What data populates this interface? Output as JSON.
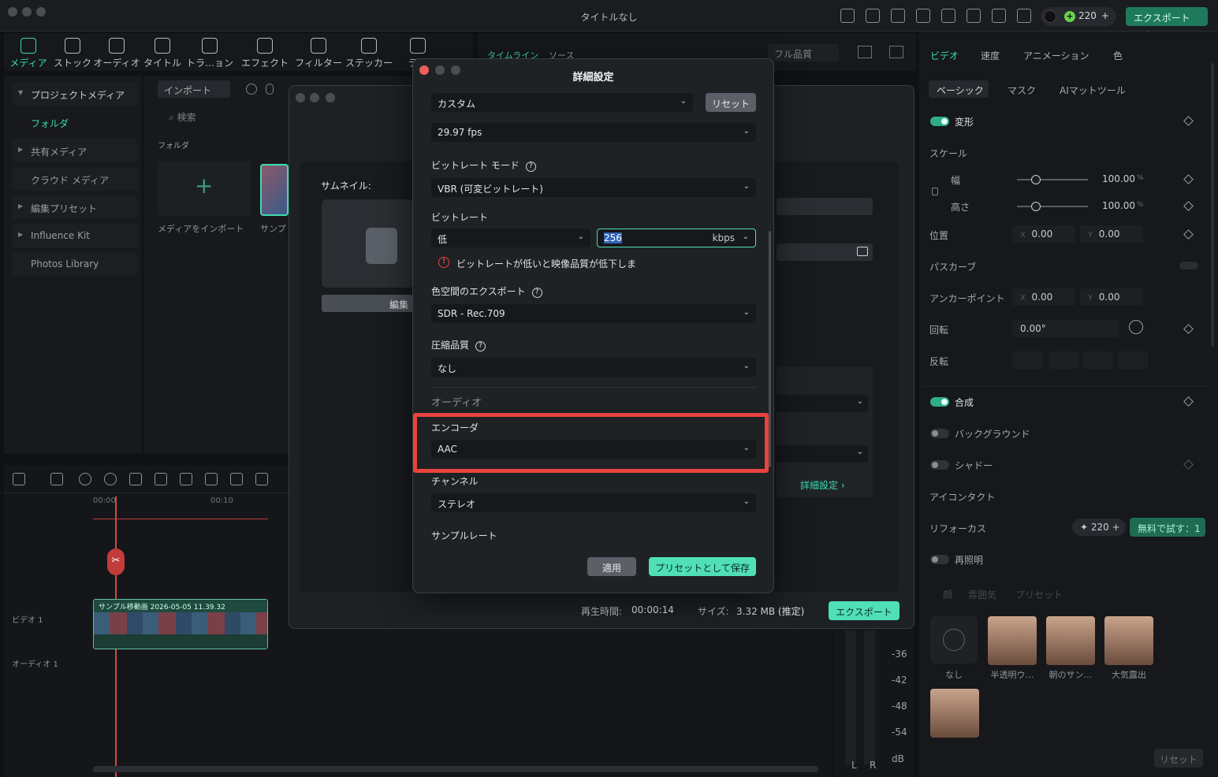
{
  "app": {
    "title": "タイトルなし",
    "credits": "220",
    "export_label": "エクスポート"
  },
  "nav": [
    {
      "label": "メディア",
      "icon": "media-icon",
      "active": true
    },
    {
      "label": "ストック",
      "icon": "stock-icon"
    },
    {
      "label": "オーディオ",
      "icon": "audio-icon"
    },
    {
      "label": "タイトル",
      "icon": "title-icon"
    },
    {
      "label": "トラ…ョン",
      "icon": "transition-icon"
    },
    {
      "label": "エフェクト",
      "icon": "effect-icon"
    },
    {
      "label": "フィルター",
      "icon": "filter-icon"
    },
    {
      "label": "ステッカー",
      "icon": "sticker-icon"
    },
    {
      "label": "テン",
      "icon": "template-icon"
    }
  ],
  "sidebar": {
    "items": [
      "プロジェクトメディア",
      "フォルダ",
      "共有メディア",
      "クラウド メディア",
      "編集プリセット",
      "Influence Kit",
      "Photos Library"
    ]
  },
  "media": {
    "import_label": "インポート",
    "search_placeholder": "検索",
    "folder_label": "フォルダ",
    "import_media": "メディアをインポート",
    "sample": "サンプ"
  },
  "preview": {
    "tabs": [
      "タイムライン",
      "ソース"
    ],
    "quality": "フル品質"
  },
  "export_dialog": {
    "thumbnail_label": "サムネイル:",
    "edit_label": "編集",
    "advanced_link": "詳細設定",
    "duration_label": "再生時間:",
    "duration": "00:00:14",
    "size_label": "サイズ:",
    "size": "3.32 MB (推定)",
    "export_button": "エクスポート"
  },
  "advanced": {
    "title": "詳細設定",
    "preset": "カスタム",
    "reset": "リセット",
    "fps": "29.97 fps",
    "bitrate_mode_label": "ビットレート モード",
    "bitrate_mode": "VBR (可変ビットレート)",
    "bitrate_label": "ビットレート",
    "bitrate_level": "低",
    "bitrate_value": "256",
    "bitrate_unit": "kbps",
    "warning": "ビットレートが低いと映像品質が低下しま",
    "color_space_label": "色空間のエクスポート",
    "color_space": "SDR - Rec.709",
    "compression_label": "圧縮品質",
    "compression": "なし",
    "audio_section": "オーディオ",
    "encoder_label": "エンコーダ",
    "encoder": "AAC",
    "channel_label": "チャンネル",
    "channel": "ステレオ",
    "samplerate_label": "サンプルレート",
    "apply": "適用",
    "save_preset": "プリセットとして保存",
    "highlight_color": "#e8433e"
  },
  "timeline": {
    "time_start": "00:00",
    "time_mark": "00:10",
    "video_track": "ビデオ 1",
    "audio_track": "オーディオ 1",
    "clip_name": "サンプル移動画 2026-05-05 11.39.32"
  },
  "meter": {
    "levels": [
      "-36",
      "-42",
      "-48",
      "-54"
    ],
    "unit": "dB",
    "left": "L",
    "right": "R"
  },
  "inspector": {
    "tabs": [
      "ビデオ",
      "速度",
      "アニメーション",
      "色"
    ],
    "subtabs": [
      "ベーシック",
      "マスク",
      "AIマットツール"
    ],
    "transform": "変形",
    "scale": "スケール",
    "width": "幅",
    "height": "高さ",
    "scale_w": "100.00",
    "scale_h": "100.00",
    "pct": "%",
    "position": "位置",
    "pos_x": "0.00",
    "pos_y": "0.00",
    "x": "X",
    "y": "Y",
    "path_curve": "パスカーブ",
    "anchor": "アンカーポイント",
    "anchor_x": "0.00",
    "anchor_y": "0.00",
    "rotate": "回転",
    "rotate_val": "0.00°",
    "flip": "反転",
    "composite": "合成",
    "background": "バックグラウンド",
    "shadow": "シャドー",
    "eye_contact": "アイコンタクト",
    "refocus": "リフォーカス",
    "refocus_credits": "220",
    "try_free": "無料で試す：1",
    "relight": "再照明",
    "relight_tabs": [
      "顔",
      "雰囲気",
      "プリセット"
    ],
    "presets": [
      "なし",
      "半透明ウ…",
      "朝のサン…",
      "大気露出"
    ],
    "reset": "リセット"
  }
}
